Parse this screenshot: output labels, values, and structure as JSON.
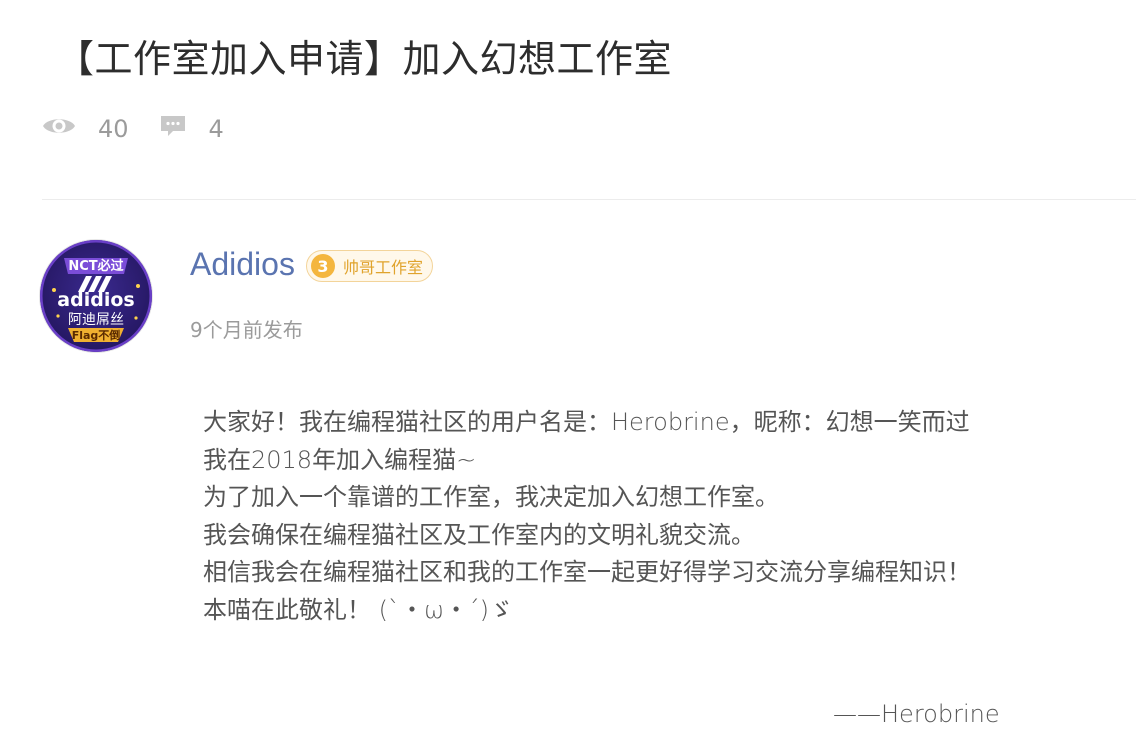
{
  "post": {
    "title": "【工作室加入申请】加入幻想工作室",
    "stats": {
      "views": "40",
      "comments": "4"
    }
  },
  "author": {
    "name": "Adidios",
    "badge_level": "3",
    "badge_label": "帅哥工作室",
    "posted_time": "9个月前发布",
    "avatar_text": {
      "top": "NCT必过",
      "logo": "adidios",
      "middle": "阿迪屌丝",
      "bottom": "Flag不倒"
    }
  },
  "content": {
    "lines": [
      "大家好！我在编程猫社区的用户名是：Herobrine，昵称：幻想一笑而过",
      "我在2018年加入编程猫~",
      "为了加入一个靠谱的工作室，我决定加入幻想工作室。",
      "我会确保在编程猫社区及工作室内的文明礼貌交流。",
      "相信我会在编程猫社区和我的工作室一起更好得学习交流分享编程知识！",
      "本喵在此敬礼！ (`・ω・´)ゞ"
    ],
    "signature": "——Herobrine"
  },
  "colors": {
    "author_name": "#5a74b0",
    "badge_gold": "#f4b63e",
    "icon_gray": "#c8c8c8"
  }
}
